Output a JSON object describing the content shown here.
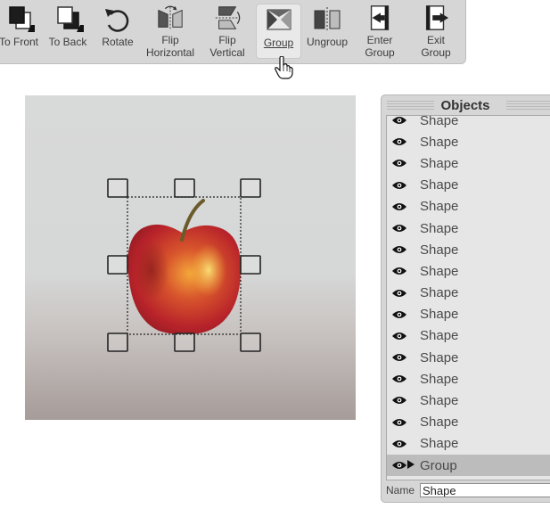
{
  "toolbar": {
    "buttons": [
      {
        "label": "To Front"
      },
      {
        "label": "To Back"
      },
      {
        "label": "Rotate"
      },
      {
        "label": "Flip\nHorizontal"
      },
      {
        "label": "Flip\nVertical"
      },
      {
        "label": "Group"
      },
      {
        "label": "Ungroup"
      },
      {
        "label": "Enter\nGroup"
      },
      {
        "label": "Exit\nGroup"
      }
    ]
  },
  "panel": {
    "title": "Objects",
    "items": [
      {
        "label": "Shape"
      },
      {
        "label": "Shape"
      },
      {
        "label": "Shape"
      },
      {
        "label": "Shape"
      },
      {
        "label": "Shape"
      },
      {
        "label": "Shape"
      },
      {
        "label": "Shape"
      },
      {
        "label": "Shape"
      },
      {
        "label": "Shape"
      },
      {
        "label": "Shape"
      },
      {
        "label": "Shape"
      },
      {
        "label": "Shape"
      },
      {
        "label": "Shape"
      },
      {
        "label": "Shape"
      },
      {
        "label": "Shape"
      },
      {
        "label": "Shape"
      },
      {
        "label": "Group"
      }
    ],
    "name_label": "Name",
    "name_value": "Shape"
  },
  "colors": {
    "toolbar_bg": "#d6d6d6",
    "panel_bg": "#d6d6d6",
    "selected_row": "#bcbcbc",
    "apple_red": "#b8232a",
    "apple_yellow": "#f0b23c"
  }
}
